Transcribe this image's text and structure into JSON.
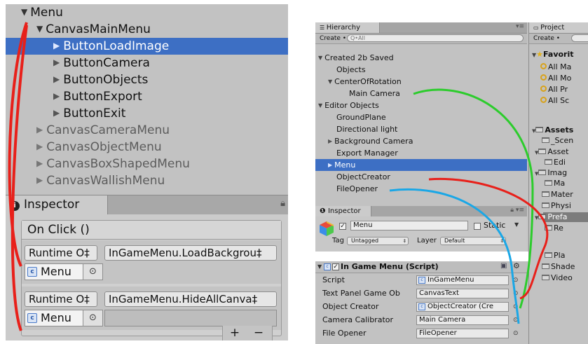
{
  "left": {
    "tree": [
      {
        "label": "Menu",
        "expand": "down",
        "selected": false,
        "dim": false
      },
      {
        "label": "CanvasMainMenu",
        "expand": "down",
        "selected": false,
        "dim": false
      },
      {
        "label": "ButtonLoadImage",
        "expand": "right",
        "selected": true,
        "dim": false
      },
      {
        "label": "ButtonCamera",
        "expand": "right",
        "selected": false,
        "dim": false
      },
      {
        "label": "ButtonObjects",
        "expand": "right",
        "selected": false,
        "dim": false
      },
      {
        "label": "ButtonExport",
        "expand": "right",
        "selected": false,
        "dim": false
      },
      {
        "label": "ButtonExit",
        "expand": "right",
        "selected": false,
        "dim": false
      },
      {
        "label": "CanvasCameraMenu",
        "expand": "right",
        "selected": false,
        "dim": true
      },
      {
        "label": "CanvasObjectMenu",
        "expand": "right",
        "selected": false,
        "dim": true
      },
      {
        "label": "CanvasBoxShapedMenu",
        "expand": "right",
        "selected": false,
        "dim": true
      },
      {
        "label": "CanvasWallishMenu",
        "expand": "right",
        "selected": false,
        "dim": true
      }
    ],
    "inspector_tab": "Inspector",
    "onclick_header": "On Click ()",
    "events": [
      {
        "mode": "Runtime O‡",
        "function": "InGameMenu.LoadBackgrou‡",
        "object": "Menu",
        "arg": ""
      },
      {
        "mode": "Runtime O‡",
        "function": "InGameMenu.HideAllCanva‡",
        "object": "Menu",
        "arg": ""
      }
    ],
    "plus": "+",
    "minus": "−"
  },
  "hierarchy": {
    "tab": "Hierarchy",
    "create": "Create •",
    "search_placeholder": "Q•All",
    "rows": [
      {
        "label": "Created 2b Saved",
        "indent": 0,
        "expand": "down",
        "selected": false
      },
      {
        "label": "Objects",
        "indent": 1,
        "expand": "none",
        "selected": false
      },
      {
        "label": "CenterOfRotation",
        "indent": 1,
        "expand": "down",
        "selected": false
      },
      {
        "label": "Main Camera",
        "indent": 2,
        "expand": "none",
        "selected": false
      },
      {
        "label": "Editor Objects",
        "indent": 0,
        "expand": "down",
        "selected": false
      },
      {
        "label": "GroundPlane",
        "indent": 1,
        "expand": "none",
        "selected": false
      },
      {
        "label": "Directional light",
        "indent": 1,
        "expand": "none",
        "selected": false
      },
      {
        "label": "Background Camera",
        "indent": 1,
        "expand": "right",
        "selected": false
      },
      {
        "label": "Export Manager",
        "indent": 1,
        "expand": "none",
        "selected": false
      },
      {
        "label": "Menu",
        "indent": 1,
        "expand": "right",
        "selected": true
      },
      {
        "label": "ObjectCreator",
        "indent": 1,
        "expand": "none",
        "selected": false
      },
      {
        "label": "FileOpener",
        "indent": 1,
        "expand": "none",
        "selected": false
      }
    ]
  },
  "inspector": {
    "tab": "Inspector",
    "object_name": "Menu",
    "static_label": "Static",
    "tag_label": "Tag",
    "tag_value": "Untagged",
    "layer_label": "Layer",
    "layer_value": "Default",
    "component_title": "In Game Menu (Script)",
    "properties": [
      {
        "label": "Script",
        "value": "InGameMenu",
        "script_icon": true
      },
      {
        "label": "Text Panel Game Ob",
        "value": "CanvasText",
        "script_icon": false
      },
      {
        "label": "Object Creator",
        "value": "ObjectCreator (Cre",
        "script_icon": true
      },
      {
        "label": "Camera Calibrator",
        "value": "Main Camera",
        "script_icon": false
      },
      {
        "label": "File Opener",
        "value": "FileOpener",
        "script_icon": false
      }
    ]
  },
  "project": {
    "tab": "Project",
    "create": "Create •",
    "favorites": "Favorit",
    "items": [
      {
        "label": "All Ma",
        "kind": "search"
      },
      {
        "label": "All Mo",
        "kind": "search"
      },
      {
        "label": "All Pr",
        "kind": "search"
      },
      {
        "label": "All Sc",
        "kind": "search"
      },
      {
        "label": "Assets",
        "kind": "folder-open"
      },
      {
        "label": "_Scen",
        "kind": "folder"
      },
      {
        "label": "Asset",
        "kind": "folder-open"
      },
      {
        "label": "Edi",
        "kind": "folder"
      },
      {
        "label": "Imag",
        "kind": "folder-open"
      },
      {
        "label": "Ma",
        "kind": "folder"
      },
      {
        "label": "Mater",
        "kind": "folder"
      },
      {
        "label": "Physi",
        "kind": "folder"
      },
      {
        "label": "Prefa",
        "kind": "folder-open"
      },
      {
        "label": "Re",
        "kind": "folder"
      },
      {
        "label": "Pla",
        "kind": "folder"
      },
      {
        "label": "Shade",
        "kind": "folder"
      },
      {
        "label": "Video",
        "kind": "folder"
      }
    ]
  },
  "annotation_colors": {
    "red": "#e8201a",
    "green": "#2ccc2c",
    "blue": "#1aa7e6"
  }
}
